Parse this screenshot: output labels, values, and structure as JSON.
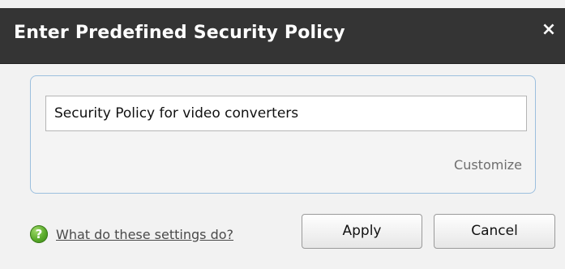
{
  "dialog": {
    "title": "Enter Predefined Security Policy",
    "close_glyph": "×",
    "policy_input": {
      "value": "Security Policy for video converters"
    },
    "customize_label": "Customize",
    "help": {
      "icon": "help-question-icon",
      "link_label": "What do these settings do?"
    },
    "buttons": {
      "apply_label": "Apply",
      "cancel_label": "Cancel"
    },
    "colors": {
      "titlebar": "#343434",
      "panel_border": "#9cbfde",
      "help_icon": "#57a928"
    }
  }
}
